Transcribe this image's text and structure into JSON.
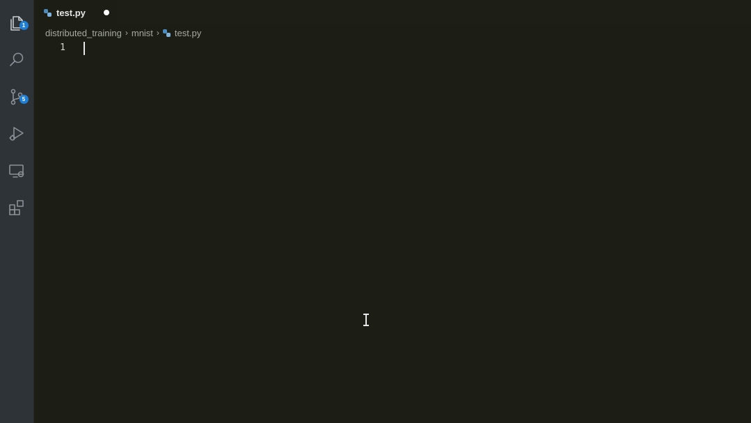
{
  "activity_bar": {
    "items": [
      {
        "icon": "explorer-files-icon",
        "badge": "1"
      },
      {
        "icon": "search-icon",
        "badge": ""
      },
      {
        "icon": "source-control-icon",
        "badge": "5"
      },
      {
        "icon": "run-debug-icon",
        "badge": ""
      },
      {
        "icon": "remote-explorer-icon",
        "badge": ""
      },
      {
        "icon": "extensions-icon",
        "badge": ""
      }
    ]
  },
  "tabs": [
    {
      "label": "test.py",
      "modified": true,
      "icon": "python-file-icon"
    }
  ],
  "breadcrumbs": {
    "parts": [
      "distributed_training",
      "mnist",
      "test.py"
    ]
  },
  "editor": {
    "line_numbers": [
      "1"
    ],
    "content": ""
  },
  "colors": {
    "editor_background": "#1c1e16",
    "activity_bar": "#2e3338",
    "badge": "#1f7ed6"
  }
}
